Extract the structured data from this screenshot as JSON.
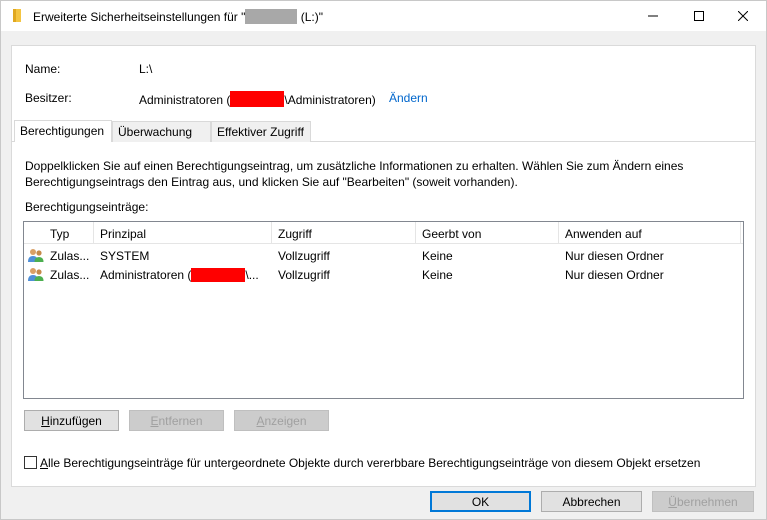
{
  "window": {
    "title_prefix": "Erweiterte Sicherheitseinstellungen für \"",
    "title_suffix": " (L:)\""
  },
  "name_row": {
    "label": "Name:",
    "value": "L:\\"
  },
  "owner_row": {
    "label": "Besitzer:",
    "value_prefix": "Administratoren (",
    "value_suffix": "\\Administratoren)",
    "change_link": "Ändern"
  },
  "tabs": [
    {
      "label": "Berechtigungen",
      "active": true
    },
    {
      "label": "Überwachung",
      "active": false
    },
    {
      "label": "Effektiver Zugriff",
      "active": false
    }
  ],
  "info_text_line1": "Doppelklicken Sie auf einen Berechtigungseintrag, um zusätzliche Informationen zu erhalten. Wählen Sie zum Ändern eines",
  "info_text_line2": "Berechtigungseintrags den Eintrag aus, und klicken Sie auf \"Bearbeiten\" (soweit vorhanden).",
  "entries_label": "Berechtigungseinträge:",
  "columns": [
    "Typ",
    "Prinzipal",
    "Zugriff",
    "Geerbt von",
    "Anwenden auf"
  ],
  "rows": [
    {
      "type": "Zulas...",
      "principal": "SYSTEM",
      "access": "Vollzugriff",
      "inherited": "Keine",
      "applies": "Nur diesen Ordner"
    },
    {
      "type": "Zulas...",
      "principal_prefix": "Administratoren (",
      "principal_suffix": "\\...",
      "access": "Vollzugriff",
      "inherited": "Keine",
      "applies": "Nur diesen Ordner"
    }
  ],
  "buttons": {
    "add": {
      "u": "H",
      "rest": "inzufügen"
    },
    "remove": {
      "u": "E",
      "rest": "ntfernen"
    },
    "view": {
      "u": "A",
      "rest": "nzeigen"
    }
  },
  "replace_checkbox": {
    "u": "A",
    "rest": "lle Berechtigungseinträge für untergeordnete Objekte durch vererbbare Berechtigungseinträge von diesem Objekt ersetzen"
  },
  "dialog_buttons": {
    "ok": "OK",
    "cancel": "Abbrechen",
    "apply": {
      "u": "Ü",
      "rest": "bernehmen"
    }
  },
  "colors": {
    "link": "#0066cc",
    "redaction": "#ff0000",
    "default_border": "#0078d7"
  },
  "icons": [
    "folder-icon",
    "minimize-icon",
    "maximize-icon",
    "close-icon",
    "users-icon"
  ]
}
